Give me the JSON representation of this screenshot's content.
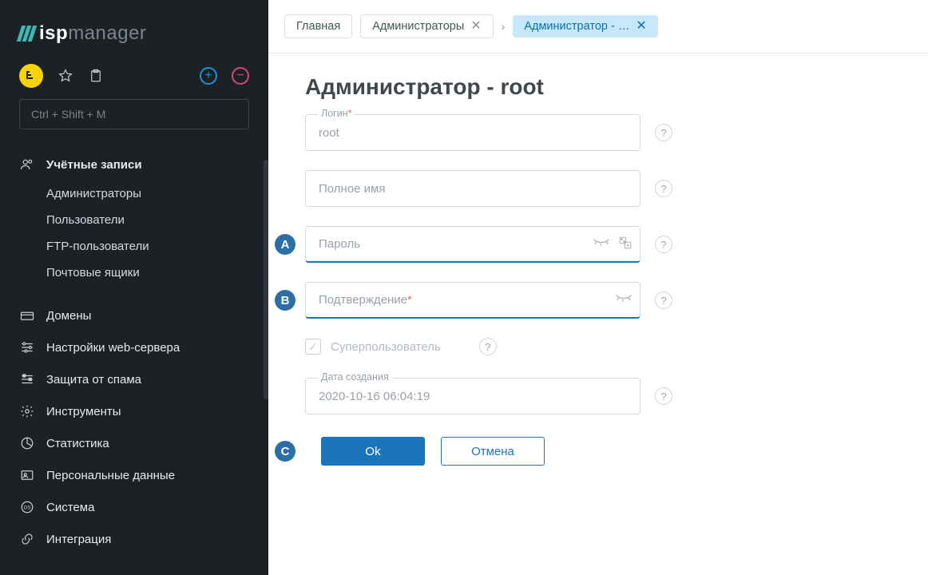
{
  "logo": {
    "bold": "isp",
    "thin": "manager"
  },
  "search_placeholder": "Ctrl + Shift + M",
  "sidebar": {
    "accounts": {
      "label": "Учётные записи",
      "items": [
        "Администраторы",
        "Пользователи",
        "FTP-пользователи",
        "Почтовые ящики"
      ]
    },
    "rest": [
      "Домены",
      "Настройки web-сервера",
      "Защита от спама",
      "Инструменты",
      "Статистика",
      "Персональные данные",
      "Система",
      "Интеграция"
    ]
  },
  "breadcrumbs": {
    "home": "Главная",
    "admins": "Администраторы",
    "current": "Администратор - …"
  },
  "page_title": "Администратор - root",
  "form": {
    "login_label": "Логин",
    "login_value": "root",
    "fullname_placeholder": "Полное имя",
    "password_placeholder": "Пароль",
    "confirm_placeholder": "Подтверждение",
    "superuser_label": "Суперпользователь",
    "created_label": "Дата создания",
    "created_value": "2020-10-16 06:04:19"
  },
  "markers": {
    "a": "A",
    "b": "B",
    "c": "C"
  },
  "actions": {
    "ok": "Ok",
    "cancel": "Отмена"
  }
}
